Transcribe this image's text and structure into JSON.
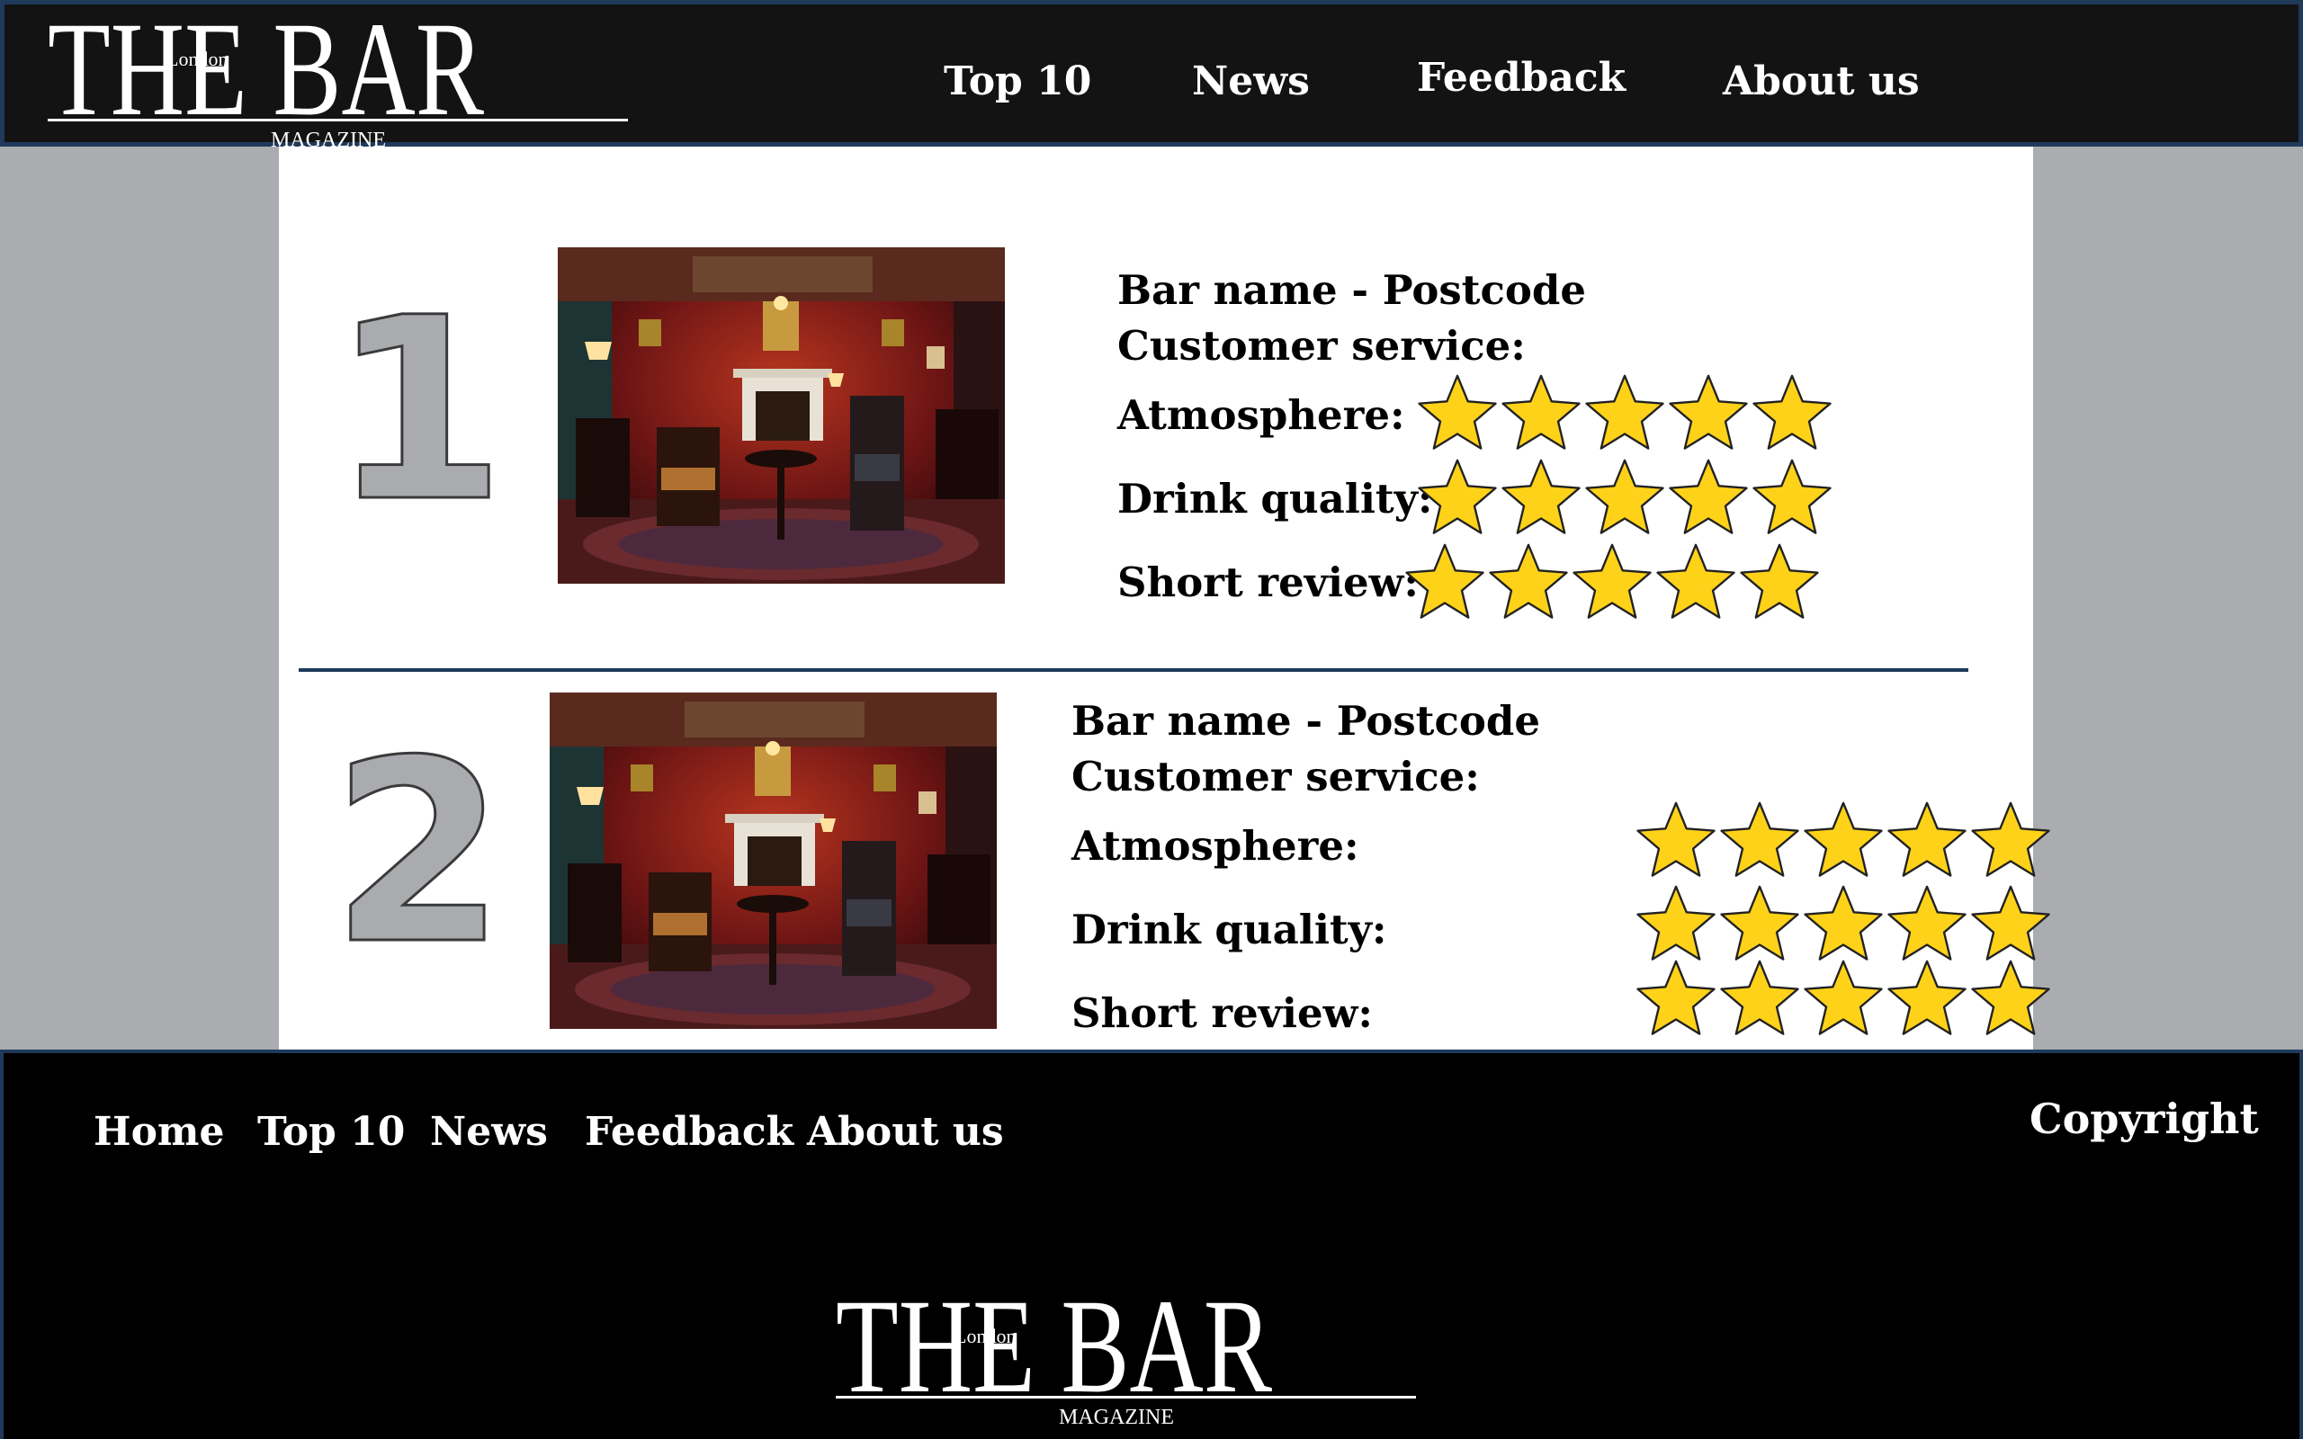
{
  "brand": {
    "name": "THE BAR",
    "city": "London",
    "subtitle": "MAGAZINE"
  },
  "header_nav": [
    {
      "label": "Top 10"
    },
    {
      "label": "News"
    },
    {
      "label": "Feedback"
    },
    {
      "label": "About us"
    }
  ],
  "entries": [
    {
      "rank": "1",
      "title": "Bar name - Postcode",
      "customer_service_label": "Customer  service:",
      "atmosphere_label": "Atmosphere:",
      "atmosphere_stars": 5,
      "drink_quality_label": "Drink quality:",
      "drink_quality_stars": 5,
      "short_review_label": "Short review:",
      "short_review_stars": 5
    },
    {
      "rank": "2",
      "title": "Bar name - Postcode",
      "customer_service_label": "Customer  service:",
      "atmosphere_label": "Atmosphere:",
      "atmosphere_stars": 5,
      "drink_quality_label": "Drink quality:",
      "drink_quality_stars": 5,
      "short_review_label": "Short review:",
      "short_review_stars": 5
    }
  ],
  "footer_nav": [
    {
      "label": "Home"
    },
    {
      "label": "Top 10"
    },
    {
      "label": "News"
    },
    {
      "label": "Feedback"
    },
    {
      "label": "About us"
    }
  ],
  "footer": {
    "copyright": "Copyright"
  },
  "colors": {
    "star_fill": "#ffd21a",
    "rank_fill": "#a9abae",
    "header_bg": "#131314",
    "divider": "#1f3a5a"
  },
  "icons": {
    "rating": "star-icon"
  }
}
